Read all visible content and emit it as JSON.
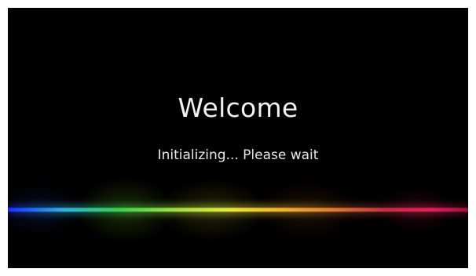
{
  "screen": {
    "title": "Welcome",
    "status": "Initializing... Please wait"
  },
  "colors": {
    "background": "#000000",
    "text": "#f2f2f2",
    "accent_gradient": [
      "#1a2cff",
      "#2fb0e0",
      "#38d050",
      "#9ee040",
      "#e8e840",
      "#f0b030",
      "#e08030",
      "#c03040",
      "#e0205a"
    ]
  }
}
